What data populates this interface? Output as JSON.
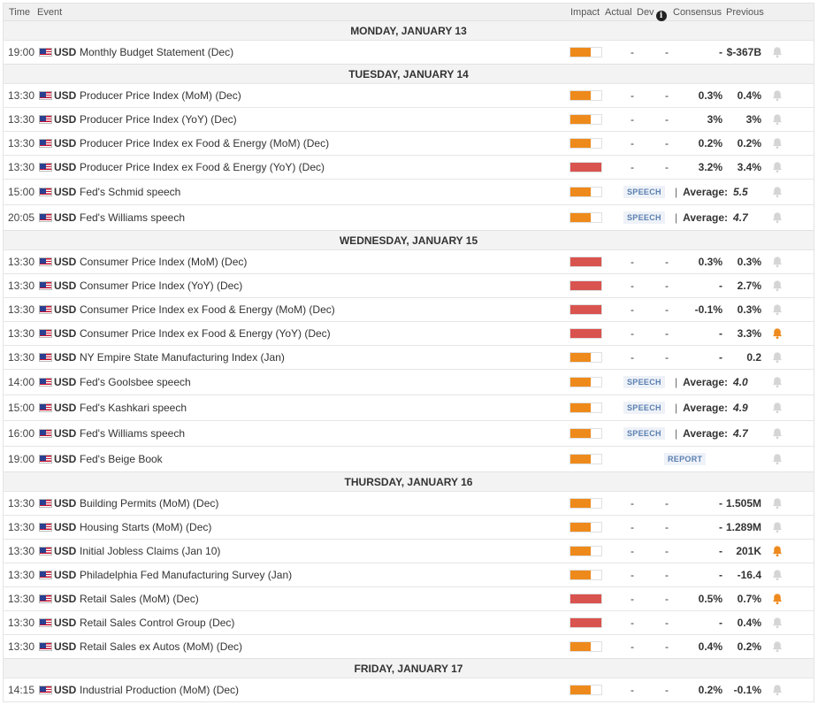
{
  "header": {
    "time": "Time",
    "event": "Event",
    "impact": "Impact",
    "actual": "Actual",
    "dev": "Dev",
    "consensus": "Consensus",
    "previous": "Previous"
  },
  "colors": {
    "medium_impact": "#ee8a1b",
    "high_impact": "#d9534f",
    "bell_active": "#ef8a1f",
    "bell_inactive": "#d5d5d5"
  },
  "days": [
    {
      "label": "MONDAY, JANUARY 13",
      "events": [
        {
          "time": "19:00",
          "currency": "USD",
          "name": "Monthly Budget Statement (Dec)",
          "impact": "medium",
          "actual": "-",
          "dev": "-",
          "consensus": "-",
          "previous": "$-367B",
          "alert": false
        }
      ]
    },
    {
      "label": "TUESDAY, JANUARY 14",
      "events": [
        {
          "time": "13:30",
          "currency": "USD",
          "name": "Producer Price Index (MoM) (Dec)",
          "impact": "medium",
          "actual": "-",
          "dev": "-",
          "consensus": "0.3%",
          "previous": "0.4%",
          "alert": false
        },
        {
          "time": "13:30",
          "currency": "USD",
          "name": "Producer Price Index (YoY) (Dec)",
          "impact": "medium",
          "actual": "-",
          "dev": "-",
          "consensus": "3%",
          "previous": "3%",
          "alert": false
        },
        {
          "time": "13:30",
          "currency": "USD",
          "name": "Producer Price Index ex Food & Energy (MoM) (Dec)",
          "impact": "medium",
          "actual": "-",
          "dev": "-",
          "consensus": "0.2%",
          "previous": "0.2%",
          "alert": false
        },
        {
          "time": "13:30",
          "currency": "USD",
          "name": "Producer Price Index ex Food & Energy (YoY) (Dec)",
          "impact": "high",
          "actual": "-",
          "dev": "-",
          "consensus": "3.2%",
          "previous": "3.4%",
          "alert": false
        },
        {
          "time": "15:00",
          "currency": "USD",
          "name": "Fed's Schmid speech",
          "impact": "medium",
          "tag": "SPEECH",
          "sep": "|",
          "avg_label": "Average:",
          "avg_value": "5.5",
          "alert": false
        },
        {
          "time": "20:05",
          "currency": "USD",
          "name": "Fed's Williams speech",
          "impact": "medium",
          "tag": "SPEECH",
          "sep": "|",
          "avg_label": "Average:",
          "avg_value": "4.7",
          "alert": false
        }
      ]
    },
    {
      "label": "WEDNESDAY, JANUARY 15",
      "events": [
        {
          "time": "13:30",
          "currency": "USD",
          "name": "Consumer Price Index (MoM) (Dec)",
          "impact": "high",
          "actual": "-",
          "dev": "-",
          "consensus": "0.3%",
          "previous": "0.3%",
          "alert": false
        },
        {
          "time": "13:30",
          "currency": "USD",
          "name": "Consumer Price Index (YoY) (Dec)",
          "impact": "high",
          "actual": "-",
          "dev": "-",
          "consensus": "-",
          "previous": "2.7%",
          "alert": false
        },
        {
          "time": "13:30",
          "currency": "USD",
          "name": "Consumer Price Index ex Food & Energy (MoM) (Dec)",
          "impact": "high",
          "actual": "-",
          "dev": "-",
          "consensus": "-0.1%",
          "previous": "0.3%",
          "alert": false
        },
        {
          "time": "13:30",
          "currency": "USD",
          "name": "Consumer Price Index ex Food & Energy (YoY) (Dec)",
          "impact": "high",
          "actual": "-",
          "dev": "-",
          "consensus": "-",
          "previous": "3.3%",
          "alert": true
        },
        {
          "time": "13:30",
          "currency": "USD",
          "name": "NY Empire State Manufacturing Index (Jan)",
          "impact": "medium",
          "actual": "-",
          "dev": "-",
          "consensus": "-",
          "previous": "0.2",
          "alert": false
        },
        {
          "time": "14:00",
          "currency": "USD",
          "name": "Fed's Goolsbee speech",
          "impact": "medium",
          "tag": "SPEECH",
          "sep": "|",
          "avg_label": "Average:",
          "avg_value": "4.0",
          "alert": false
        },
        {
          "time": "15:00",
          "currency": "USD",
          "name": "Fed's Kashkari speech",
          "impact": "medium",
          "tag": "SPEECH",
          "sep": "|",
          "avg_label": "Average:",
          "avg_value": "4.9",
          "alert": false
        },
        {
          "time": "16:00",
          "currency": "USD",
          "name": "Fed's Williams speech",
          "impact": "medium",
          "tag": "SPEECH",
          "sep": "|",
          "avg_label": "Average:",
          "avg_value": "4.7",
          "alert": false
        },
        {
          "time": "19:00",
          "currency": "USD",
          "name": "Fed's Beige Book",
          "impact": "medium",
          "tag": "REPORT",
          "alert": false
        }
      ]
    },
    {
      "label": "THURSDAY, JANUARY 16",
      "events": [
        {
          "time": "13:30",
          "currency": "USD",
          "name": "Building Permits (MoM) (Dec)",
          "impact": "medium",
          "actual": "-",
          "dev": "-",
          "consensus": "-",
          "previous": "1.505M",
          "alert": false
        },
        {
          "time": "13:30",
          "currency": "USD",
          "name": "Housing Starts (MoM) (Dec)",
          "impact": "medium",
          "actual": "-",
          "dev": "-",
          "consensus": "-",
          "previous": "1.289M",
          "alert": false
        },
        {
          "time": "13:30",
          "currency": "USD",
          "name": "Initial Jobless Claims (Jan 10)",
          "impact": "medium",
          "actual": "-",
          "dev": "-",
          "consensus": "-",
          "previous": "201K",
          "alert": true
        },
        {
          "time": "13:30",
          "currency": "USD",
          "name": "Philadelphia Fed Manufacturing Survey (Jan)",
          "impact": "medium",
          "actual": "-",
          "dev": "-",
          "consensus": "-",
          "previous": "-16.4",
          "alert": false
        },
        {
          "time": "13:30",
          "currency": "USD",
          "name": "Retail Sales (MoM) (Dec)",
          "impact": "high",
          "actual": "-",
          "dev": "-",
          "consensus": "0.5%",
          "previous": "0.7%",
          "alert": true
        },
        {
          "time": "13:30",
          "currency": "USD",
          "name": "Retail Sales Control Group (Dec)",
          "impact": "high",
          "actual": "-",
          "dev": "-",
          "consensus": "-",
          "previous": "0.4%",
          "alert": false
        },
        {
          "time": "13:30",
          "currency": "USD",
          "name": "Retail Sales ex Autos (MoM) (Dec)",
          "impact": "medium",
          "actual": "-",
          "dev": "-",
          "consensus": "0.4%",
          "previous": "0.2%",
          "alert": false
        }
      ]
    },
    {
      "label": "FRIDAY, JANUARY 17",
      "events": [
        {
          "time": "14:15",
          "currency": "USD",
          "name": "Industrial Production (MoM) (Dec)",
          "impact": "medium",
          "actual": "-",
          "dev": "-",
          "consensus": "0.2%",
          "previous": "-0.1%",
          "alert": false
        }
      ]
    }
  ]
}
